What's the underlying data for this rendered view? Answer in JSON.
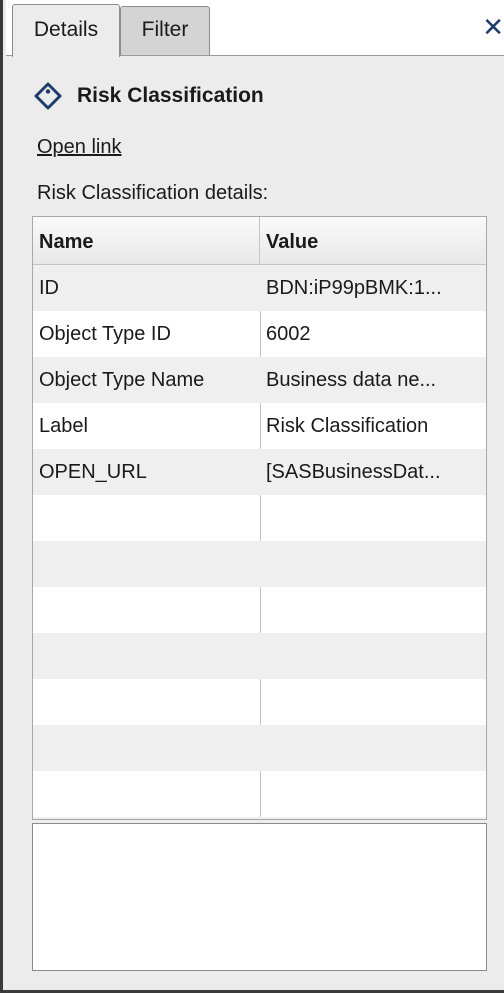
{
  "tabs": [
    {
      "label": "Details"
    },
    {
      "label": "Filter"
    }
  ],
  "header": {
    "title": "Risk Classification",
    "icon": "tag-icon"
  },
  "open_link": "Open link",
  "details_label": "Risk Classification details:",
  "table": {
    "columns": [
      "Name",
      "Value"
    ],
    "rows": [
      {
        "name": "ID",
        "value": "BDN:iP99pBMK:1..."
      },
      {
        "name": "Object Type ID",
        "value": "6002"
      },
      {
        "name": "Object Type Name",
        "value": "Business data ne..."
      },
      {
        "name": "Label",
        "value": "Risk Classification"
      },
      {
        "name": "OPEN_URL",
        "value": "[SASBusinessDat..."
      }
    ]
  },
  "colors": {
    "accent": "#1d3b6e",
    "panel": "#ececec"
  }
}
